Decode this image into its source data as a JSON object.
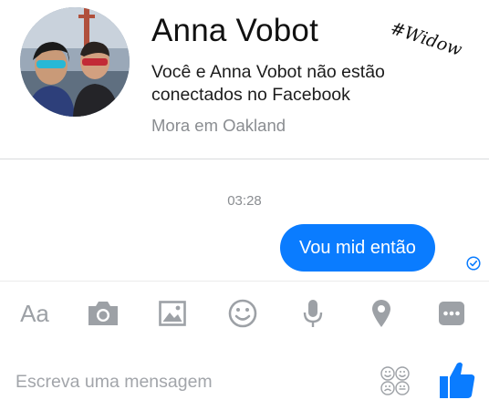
{
  "contact": {
    "name": "Anna Vobot",
    "not_connected": "Você e Anna Vobot não estão conectados no Facebook",
    "lives_in": "Mora em Oakland",
    "avatar_icon": "profile-photo"
  },
  "overlay": {
    "tag": "#Widow"
  },
  "conversation": {
    "timestamp": "03:28",
    "messages": [
      {
        "from": "me",
        "text": "Vou mid então",
        "status": "sent-check-icon"
      }
    ]
  },
  "toolbar": {
    "text_format_label": "Aa",
    "icons": [
      "camera-icon",
      "gallery-icon",
      "emoji-icon",
      "microphone-icon",
      "location-icon",
      "more-icon"
    ]
  },
  "composer": {
    "placeholder": "Escreva uma mensagem",
    "value": "",
    "sticker_icon": "sticker-icon",
    "like_icon": "thumbs-up-icon"
  },
  "colors": {
    "accent": "#0a7cff",
    "icon_gray": "#9da1a6",
    "secondary_text": "#8a8d91"
  }
}
